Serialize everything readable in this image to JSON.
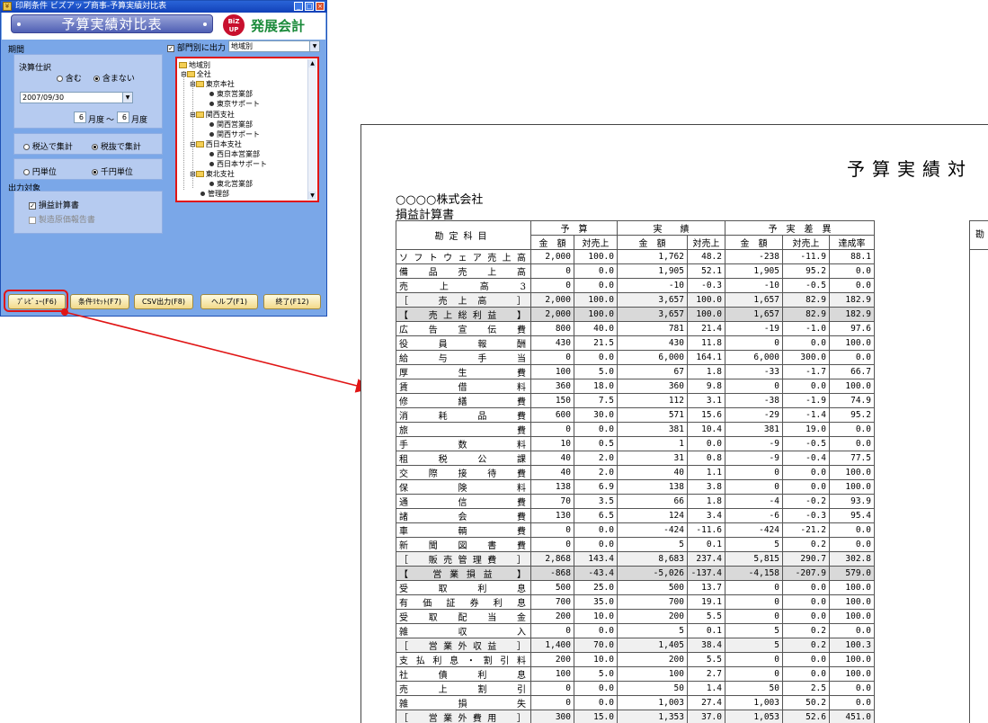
{
  "window": {
    "title": "印刷条件 ビズアップ商事-予算実績対比表",
    "banner": "予算実績対比表",
    "logo_text": "BiZ UP",
    "app_name": "発展会計",
    "btn_min": "_",
    "btn_max": "□",
    "btn_close": "×"
  },
  "period": {
    "label": "期間",
    "settlement_label": "決算仕訳",
    "include": "含む",
    "exclude": "含まない",
    "date": "2007/09/30",
    "from_month": "6",
    "to_month": "6",
    "month_label": "月度",
    "tilde": "～"
  },
  "tax": {
    "incl": "税込で集計",
    "excl": "税抜で集計"
  },
  "unit": {
    "yen": "円単位",
    "thousand": "千円単位"
  },
  "output": {
    "label": "出力対象",
    "pl": "損益計算書",
    "mfg": "製造原価報告書"
  },
  "dept": {
    "label": "部門別に出力",
    "select": "地域別"
  },
  "tree": {
    "root": "地域別",
    "all": "全社",
    "n1": "東京本社",
    "n1a": "東京営業部",
    "n1b": "東京サポート",
    "n2": "関西支社",
    "n2a": "関西営業部",
    "n2b": "関西サポート",
    "n3": "西日本支社",
    "n3a": "西日本営業部",
    "n3b": "西日本サポート",
    "n4": "東北支社",
    "n4a": "東北営業部",
    "n5": "管理部"
  },
  "buttons": {
    "preview": "ﾌﾟﾚﾋﾞｭｰ(F6)",
    "reset": "条件ﾘｾｯﾄ(F7)",
    "csv": "CSV出力(F8)",
    "help": "ヘルプ(F1)",
    "exit": "終了(F12)"
  },
  "report": {
    "title": "予算実績対",
    "company": "○○○○株式会社",
    "subtitle": "損益計算書",
    "h_account": "勘定科目",
    "h_budget": "予　算",
    "h_actual": "実　　績",
    "h_diff": "予　実　差　異",
    "h_amount": "金　額",
    "h_ratio": "対売上",
    "h_rate": "達成率",
    "h_right": "勘",
    "rows": [
      {
        "name": "ソフトウェア売上高",
        "c": [
          "2,000",
          "100.0",
          "1,762",
          "48.2",
          "-238",
          "-11.9",
          "88.1"
        ]
      },
      {
        "name": "備品売上高",
        "c": [
          "0",
          "0.0",
          "1,905",
          "52.1",
          "1,905",
          "95.2",
          "0.0"
        ]
      },
      {
        "name": "売上高3",
        "c": [
          "0",
          "0.0",
          "-10",
          "-0.3",
          "-10",
          "-0.5",
          "0.0"
        ]
      },
      {
        "name": "［　売上高　］",
        "c": [
          "2,000",
          "100.0",
          "3,657",
          "100.0",
          "1,657",
          "82.9",
          "182.9"
        ],
        "t": "sub"
      },
      {
        "name": "【　売上総利益　】",
        "c": [
          "2,000",
          "100.0",
          "3,657",
          "100.0",
          "1,657",
          "82.9",
          "182.9"
        ],
        "t": "hl"
      },
      {
        "name": "広告宣伝費",
        "c": [
          "800",
          "40.0",
          "781",
          "21.4",
          "-19",
          "-1.0",
          "97.6"
        ]
      },
      {
        "name": "役員報酬",
        "c": [
          "430",
          "21.5",
          "430",
          "11.8",
          "0",
          "0.0",
          "100.0"
        ]
      },
      {
        "name": "給与手当",
        "c": [
          "0",
          "0.0",
          "6,000",
          "164.1",
          "6,000",
          "300.0",
          "0.0"
        ]
      },
      {
        "name": "厚生費",
        "c": [
          "100",
          "5.0",
          "67",
          "1.8",
          "-33",
          "-1.7",
          "66.7"
        ]
      },
      {
        "name": "賃借料",
        "c": [
          "360",
          "18.0",
          "360",
          "9.8",
          "0",
          "0.0",
          "100.0"
        ]
      },
      {
        "name": "修繕費",
        "c": [
          "150",
          "7.5",
          "112",
          "3.1",
          "-38",
          "-1.9",
          "74.9"
        ]
      },
      {
        "name": "消耗品費",
        "c": [
          "600",
          "30.0",
          "571",
          "15.6",
          "-29",
          "-1.4",
          "95.2"
        ]
      },
      {
        "name": "旅費",
        "c": [
          "0",
          "0.0",
          "381",
          "10.4",
          "381",
          "19.0",
          "0.0"
        ]
      },
      {
        "name": "手数料",
        "c": [
          "10",
          "0.5",
          "1",
          "0.0",
          "-9",
          "-0.5",
          "0.0"
        ]
      },
      {
        "name": "租税公課",
        "c": [
          "40",
          "2.0",
          "31",
          "0.8",
          "-9",
          "-0.4",
          "77.5"
        ]
      },
      {
        "name": "交際接待費",
        "c": [
          "40",
          "2.0",
          "40",
          "1.1",
          "0",
          "0.0",
          "100.0"
        ]
      },
      {
        "name": "保険料",
        "c": [
          "138",
          "6.9",
          "138",
          "3.8",
          "0",
          "0.0",
          "100.0"
        ]
      },
      {
        "name": "通信費",
        "c": [
          "70",
          "3.5",
          "66",
          "1.8",
          "-4",
          "-0.2",
          "93.9"
        ]
      },
      {
        "name": "諸会費",
        "c": [
          "130",
          "6.5",
          "124",
          "3.4",
          "-6",
          "-0.3",
          "95.4"
        ]
      },
      {
        "name": "車輌費",
        "c": [
          "0",
          "0.0",
          "-424",
          "-11.6",
          "-424",
          "-21.2",
          "0.0"
        ]
      },
      {
        "name": "新聞図書費",
        "c": [
          "0",
          "0.0",
          "5",
          "0.1",
          "5",
          "0.2",
          "0.0"
        ]
      },
      {
        "name": "［　販売管理費　］",
        "c": [
          "2,868",
          "143.4",
          "8,683",
          "237.4",
          "5,815",
          "290.7",
          "302.8"
        ],
        "t": "sub"
      },
      {
        "name": "【　営業損益　】",
        "c": [
          "-868",
          "-43.4",
          "-5,026",
          "-137.4",
          "-4,158",
          "-207.9",
          "579.0"
        ],
        "t": "hl"
      },
      {
        "name": "受取利息",
        "c": [
          "500",
          "25.0",
          "500",
          "13.7",
          "0",
          "0.0",
          "100.0"
        ]
      },
      {
        "name": "有価証券利息",
        "c": [
          "700",
          "35.0",
          "700",
          "19.1",
          "0",
          "0.0",
          "100.0"
        ]
      },
      {
        "name": "受取配当金",
        "c": [
          "200",
          "10.0",
          "200",
          "5.5",
          "0",
          "0.0",
          "100.0"
        ]
      },
      {
        "name": "雑収入",
        "c": [
          "0",
          "0.0",
          "5",
          "0.1",
          "5",
          "0.2",
          "0.0"
        ]
      },
      {
        "name": "［　営業外収益　］",
        "c": [
          "1,400",
          "70.0",
          "1,405",
          "38.4",
          "5",
          "0.2",
          "100.3"
        ],
        "t": "sub"
      },
      {
        "name": "支払利息・割引料",
        "c": [
          "200",
          "10.0",
          "200",
          "5.5",
          "0",
          "0.0",
          "100.0"
        ]
      },
      {
        "name": "社債利息",
        "c": [
          "100",
          "5.0",
          "100",
          "2.7",
          "0",
          "0.0",
          "100.0"
        ]
      },
      {
        "name": "売上割引",
        "c": [
          "0",
          "0.0",
          "50",
          "1.4",
          "50",
          "2.5",
          "0.0"
        ]
      },
      {
        "name": "雑損失",
        "c": [
          "0",
          "0.0",
          "1,003",
          "27.4",
          "1,003",
          "50.2",
          "0.0"
        ]
      },
      {
        "name": "［　営業外費用　］",
        "c": [
          "300",
          "15.0",
          "1,353",
          "37.0",
          "1,053",
          "52.6",
          "451.0"
        ],
        "t": "sub"
      }
    ]
  }
}
